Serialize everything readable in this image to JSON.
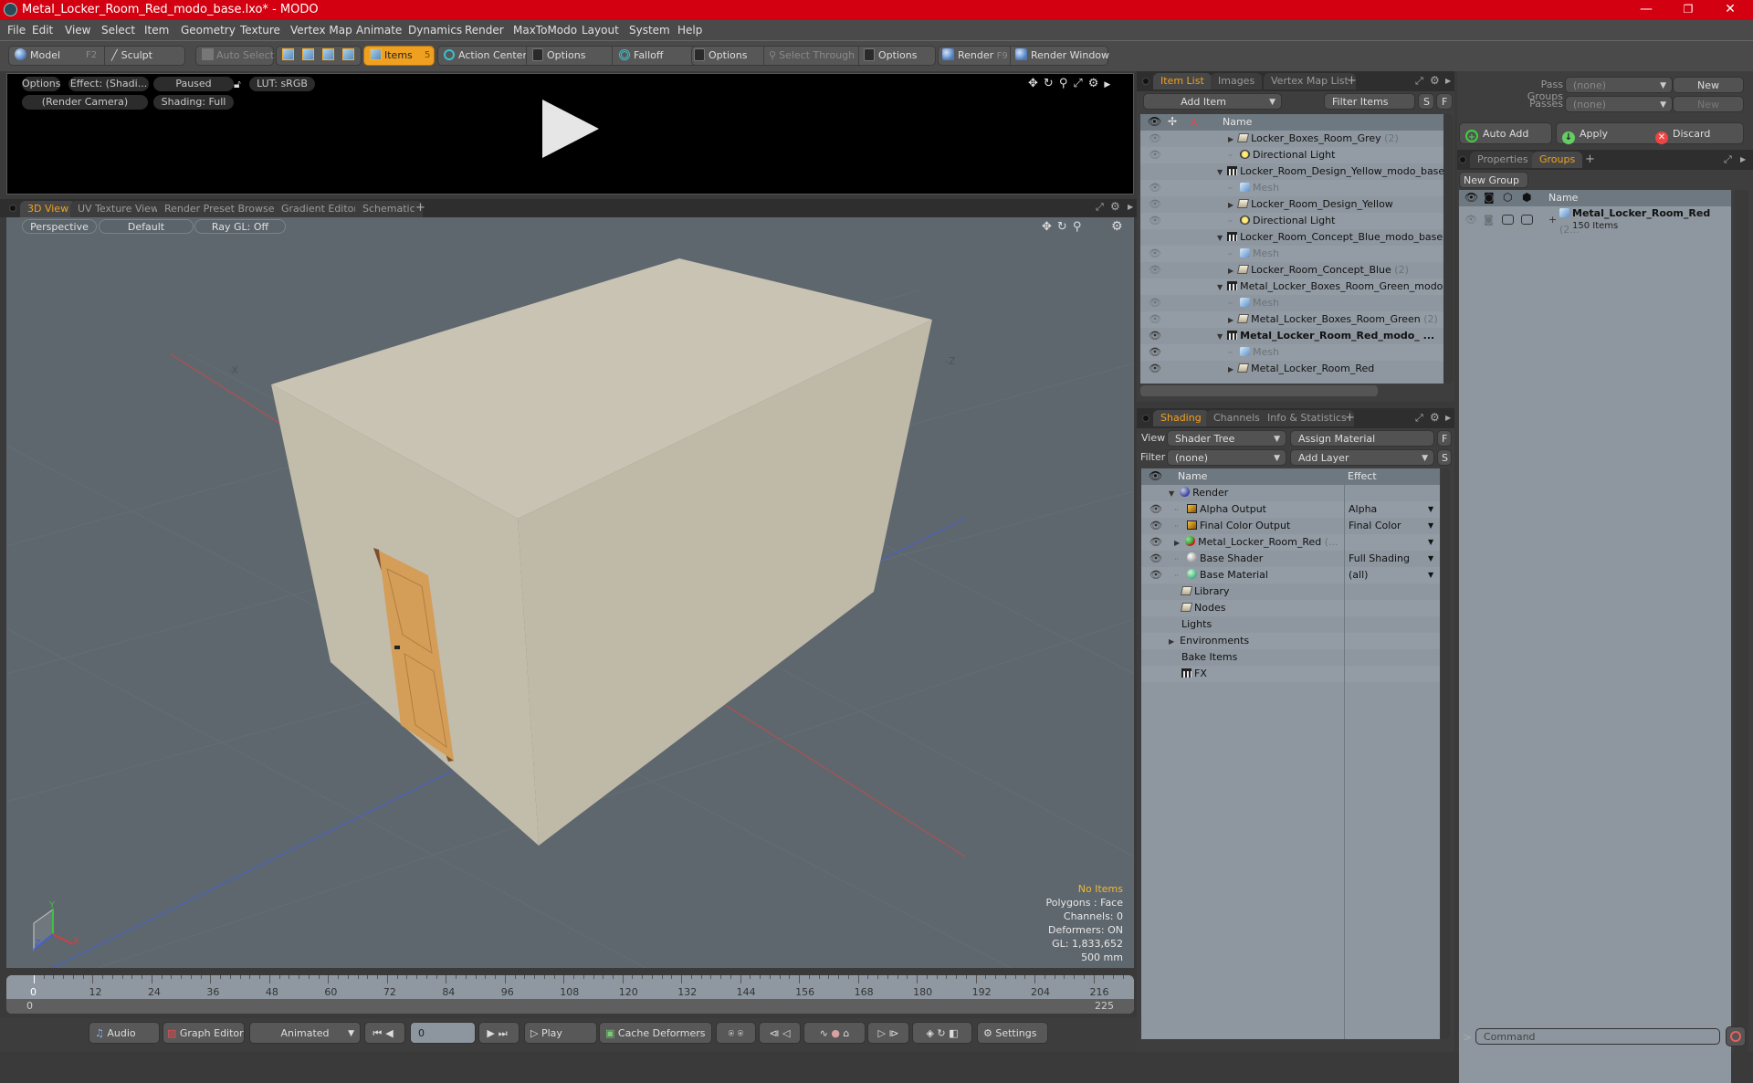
{
  "window": {
    "title": "Metal_Locker_Room_Red_modo_base.lxo* - MODO",
    "controls": {
      "minimize": "—",
      "restore": "❐",
      "close": "✕"
    }
  },
  "menu": [
    "File",
    "Edit",
    "View",
    "Select",
    "Item",
    "Geometry",
    "Texture",
    "Vertex Map",
    "Animate",
    "Dynamics",
    "Render",
    "MaxToModo",
    "Layout",
    "System",
    "Help"
  ],
  "toolbar": {
    "model": "Model",
    "model_key": "F2",
    "sculpt": "Sculpt",
    "auto_select": "Auto Select",
    "items": "Items",
    "items_key": "5",
    "action_center": "Action Center",
    "options1": "Options",
    "falloff": "Falloff",
    "options2": "Options",
    "select_through": "Select Through",
    "options3": "Options",
    "render": "Render",
    "render_key": "F9",
    "render_window": "Render Window"
  },
  "render_preview": {
    "options": "Options",
    "effect": "Effect: (Shadi...",
    "paused": "Paused",
    "lut": "LUT: sRGB",
    "camera": "(Render Camera)",
    "shading": "Shading: Full"
  },
  "viewport_tabs": [
    "3D View",
    "UV Texture View",
    "Render Preset Browser",
    "Gradient Editor",
    "Schematic"
  ],
  "viewport": {
    "projection": "Perspective",
    "style": "Default",
    "raygl": "Ray GL: Off",
    "axis_labels": {
      "neg_x": "-X",
      "neg_z": "-Z",
      "x": "X",
      "y": "Y",
      "z": "Z"
    },
    "info": {
      "selection": "No Items",
      "polygons": "Polygons : Face",
      "channels": "Channels: 0",
      "deformers": "Deformers: ON",
      "gl": "GL: 1,833,652",
      "scale": "500 mm"
    },
    "colors": {
      "background": "#5e676e",
      "box": "#c8c2b2",
      "door": "#d09a55",
      "x_axis": "#c04040",
      "z_axis": "#4a60c0"
    }
  },
  "timeline": {
    "ticks": [
      "0",
      "12",
      "24",
      "36",
      "48",
      "60",
      "72",
      "84",
      "96",
      "108",
      "120",
      "132",
      "144",
      "156",
      "168",
      "180",
      "192",
      "204",
      "216"
    ],
    "range_start": "0",
    "range_end": "225",
    "current_frame": 0,
    "total_frames": 225
  },
  "bottom_bar": {
    "audio": "Audio",
    "graph_editor": "Graph Editor",
    "animated": "Animated",
    "frame": "0",
    "play": "Play",
    "cache_deformers": "Cache Deformers",
    "settings": "Settings"
  },
  "item_list": {
    "tabs": [
      "Item List",
      "Images",
      "Vertex Map List"
    ],
    "add_item": "Add Item",
    "filter_items": "Filter Items",
    "s_btn": "S",
    "f_btn": "F",
    "header_name": "Name",
    "rows": [
      {
        "name": "Locker_Boxes_Room_Grey",
        "count": "(2)",
        "type": "folder",
        "indent": 2,
        "expander": "▶",
        "eye": "faint"
      },
      {
        "name": "Directional Light",
        "count": "",
        "type": "light",
        "indent": 2,
        "expander": "",
        "eye": "faint"
      },
      {
        "name": "Locker_Room_Design_Yellow_modo_base...",
        "count": "",
        "type": "scene",
        "indent": 1,
        "expander": "▼",
        "eye": ""
      },
      {
        "name": "Mesh",
        "count": "",
        "type": "mesh",
        "indent": 2,
        "expander": "",
        "eye": "faint"
      },
      {
        "name": "Locker_Room_Design_Yellow",
        "count": "",
        "type": "folder",
        "indent": 2,
        "expander": "▶",
        "eye": "faint"
      },
      {
        "name": "Directional Light",
        "count": "",
        "type": "light",
        "indent": 2,
        "expander": "",
        "eye": "faint"
      },
      {
        "name": "Locker_Room_Concept_Blue_modo_base...",
        "count": "",
        "type": "scene",
        "indent": 1,
        "expander": "▼",
        "eye": ""
      },
      {
        "name": "Mesh",
        "count": "",
        "type": "mesh",
        "indent": 2,
        "expander": "",
        "eye": "faint"
      },
      {
        "name": "Locker_Room_Concept_Blue",
        "count": "(2)",
        "type": "folder",
        "indent": 2,
        "expander": "▶",
        "eye": "faint"
      },
      {
        "name": "Metal_Locker_Boxes_Room_Green_modo...",
        "count": "",
        "type": "scene",
        "indent": 1,
        "expander": "▼",
        "eye": ""
      },
      {
        "name": "Mesh",
        "count": "",
        "type": "mesh",
        "indent": 2,
        "expander": "",
        "eye": "faint"
      },
      {
        "name": "Metal_Locker_Boxes_Room_Green",
        "count": "(2)",
        "type": "folder",
        "indent": 2,
        "expander": "▶",
        "eye": "faint"
      },
      {
        "name": "Metal_Locker_Room_Red_modo_ ...",
        "count": "",
        "type": "scene",
        "indent": 1,
        "expander": "▼",
        "eye": "on",
        "bold": true
      },
      {
        "name": "Mesh",
        "count": "",
        "type": "mesh",
        "indent": 2,
        "expander": "",
        "eye": "on"
      },
      {
        "name": "Metal_Locker_Room_Red",
        "count": "",
        "type": "folder",
        "indent": 2,
        "expander": "▶",
        "eye": "on"
      }
    ]
  },
  "shading": {
    "tabs": [
      "Shading",
      "Channels",
      "Info & Statistics"
    ],
    "view_label": "View",
    "view_value": "Shader Tree",
    "assign_material": "Assign Material",
    "filter_label": "Filter",
    "filter_value": "(none)",
    "add_layer": "Add Layer",
    "f_btn": "F",
    "s_btn": "S",
    "header_name": "Name",
    "header_effect": "Effect",
    "rows": [
      {
        "name": "Render",
        "effect": "",
        "icon": "render",
        "indent": 1,
        "expander": "▼",
        "eye": false
      },
      {
        "name": "Alpha Output",
        "effect": "Alpha",
        "icon": "output",
        "indent": 2,
        "expander": "",
        "eye": true
      },
      {
        "name": "Final Color Output",
        "effect": "Final Color",
        "icon": "output",
        "indent": 2,
        "expander": "",
        "eye": true
      },
      {
        "name": "Metal_Locker_Room_Red",
        "suffix": "(...",
        "effect": "",
        "icon": "material-red",
        "indent": 2,
        "expander": "▶",
        "eye": true
      },
      {
        "name": "Base Shader",
        "effect": "Full Shading",
        "icon": "shader",
        "indent": 2,
        "expander": "",
        "eye": true
      },
      {
        "name": "Base Material",
        "effect": "(all)",
        "icon": "material",
        "indent": 2,
        "expander": "",
        "eye": true
      },
      {
        "name": "Library",
        "effect": "",
        "icon": "folder",
        "indent": 1,
        "expander": "",
        "eye": false
      },
      {
        "name": "Nodes",
        "effect": "",
        "icon": "folder",
        "indent": 1,
        "expander": "",
        "eye": false
      },
      {
        "name": "Lights",
        "effect": "",
        "icon": "",
        "indent": 1,
        "expander": "",
        "eye": false
      },
      {
        "name": "Environments",
        "effect": "",
        "icon": "",
        "indent": 1,
        "expander": "▶",
        "eye": false
      },
      {
        "name": "Bake Items",
        "effect": "",
        "icon": "",
        "indent": 1,
        "expander": "",
        "eye": false
      },
      {
        "name": "FX",
        "effect": "",
        "icon": "scene",
        "indent": 1,
        "expander": "",
        "eye": false
      }
    ]
  },
  "passes": {
    "pass_groups_label": "Pass Groups",
    "pass_groups_value": "(none)",
    "pass_groups_new": "New",
    "passes_label": "Passes",
    "passes_value": "(none)",
    "passes_new": "New",
    "auto_add": "Auto Add",
    "apply": "Apply",
    "discard": "Discard"
  },
  "groups": {
    "tabs": [
      "Properties",
      "Groups"
    ],
    "new_group": "New Group",
    "header_name": "Name",
    "item_name": "Metal_Locker_Room_Red",
    "item_suffix": "(2...",
    "item_count": "150 Items"
  },
  "command": {
    "placeholder": "Command",
    "prompt": ">"
  },
  "accent_color": "#f0a020"
}
